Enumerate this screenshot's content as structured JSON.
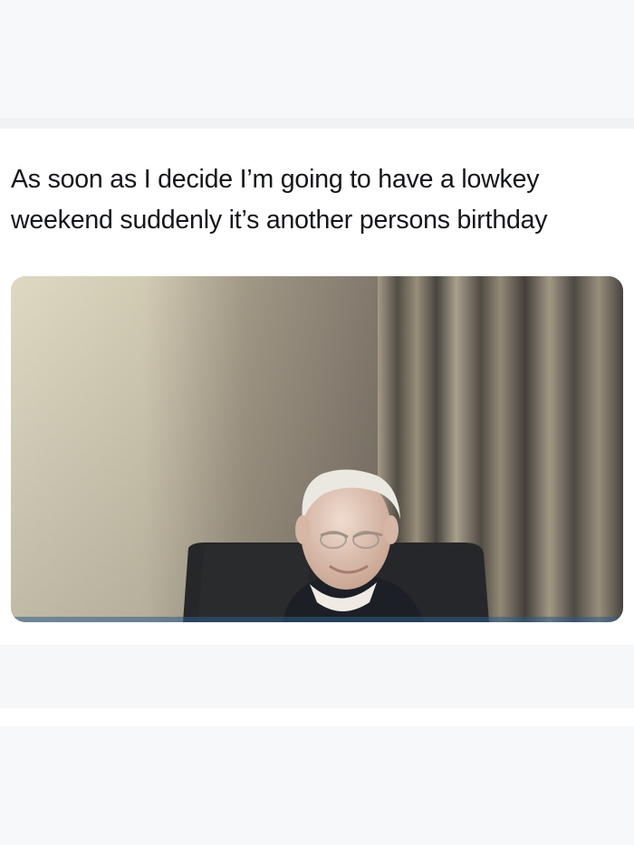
{
  "post": {
    "text_lines": [
      "As soon as I decide I’m going to have a lowkey",
      "weekend suddenly it’s another persons birthday"
    ]
  },
  "media": {
    "colors": {
      "wall_light": "#e6e1c9",
      "wall_shadow": "#8f8578",
      "curtain_dark": "#4c4843",
      "curtain_light": "#b6ab95",
      "chair": "#27282b",
      "sweater": "#1e2128",
      "skin": "#e2c0ad",
      "hair": "#eceae6"
    }
  }
}
